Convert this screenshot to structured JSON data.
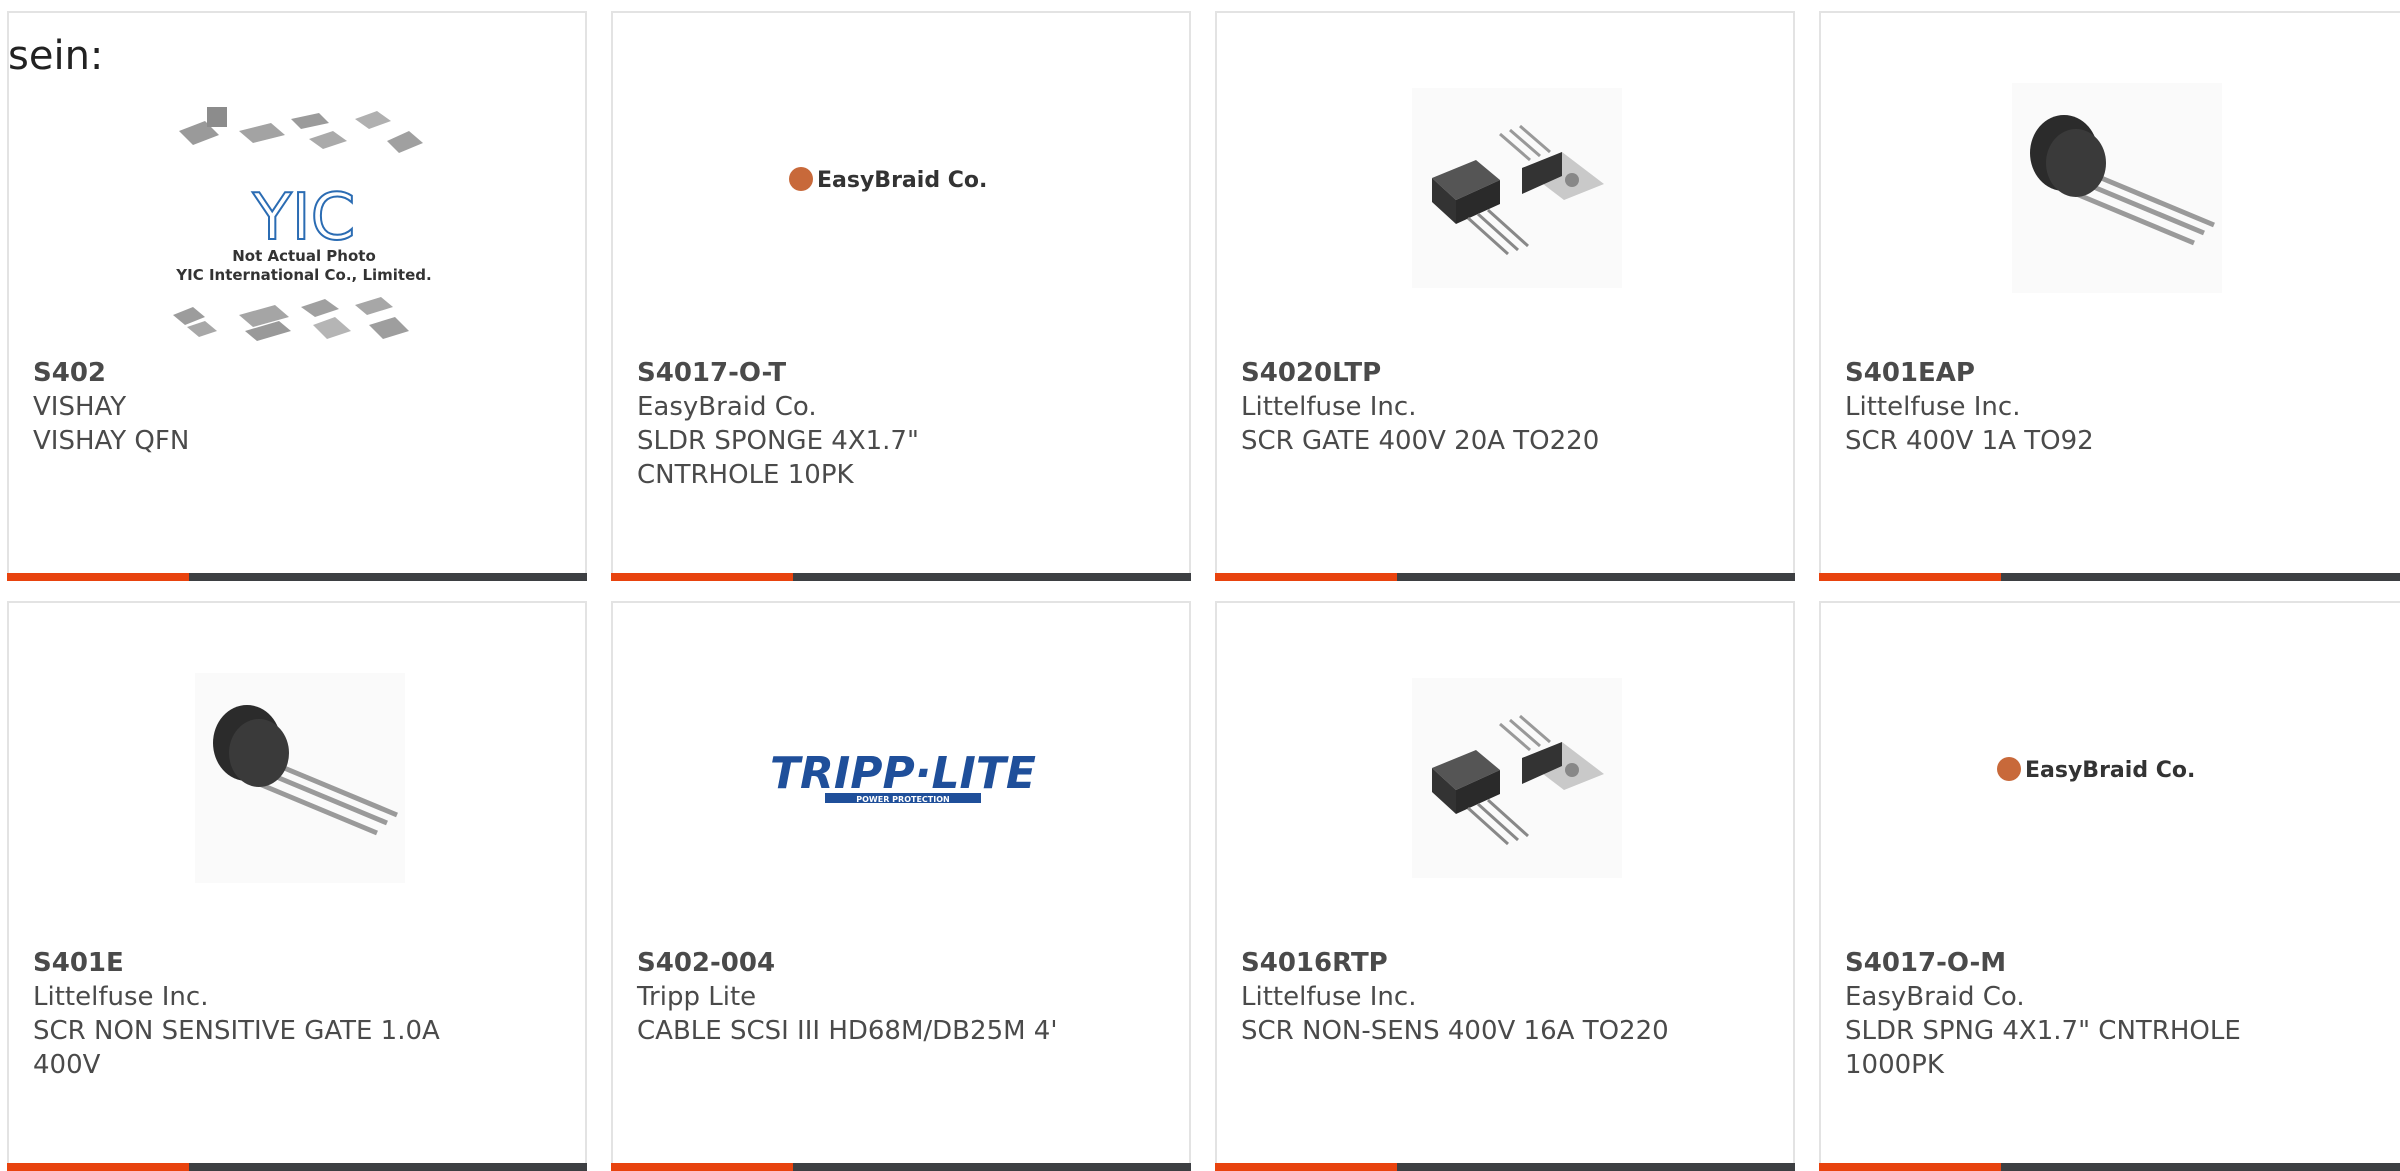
{
  "page": {
    "heading": "sein:"
  },
  "colors": {
    "accent_bar": "#e8430e",
    "dark_bar": "#3d3f42",
    "text": "#4a4a4a",
    "card_border": "#e3e3e3"
  },
  "placeholder_image": {
    "line1": "Not Actual Photo",
    "line2": "YIC International Co., Limited.",
    "logo": "YIC"
  },
  "logos": {
    "easybraid": "EasyBraid Co.",
    "tripplite": "TRIPP·LITE",
    "tripplite_tagline": "POWER PROTECTION"
  },
  "products": [
    {
      "part_number": "S402",
      "manufacturer": "VISHAY",
      "description": "VISHAY QFN",
      "image": "placeholder-chips"
    },
    {
      "part_number": "S4017-O-T",
      "manufacturer": "EasyBraid Co.",
      "description": "SLDR SPONGE 4X1.7\" CNTRHOLE 10PK",
      "image": "easybraid-logo"
    },
    {
      "part_number": "S4020LTP",
      "manufacturer": "Littelfuse Inc.",
      "description": "SCR GATE 400V 20A TO220",
      "image": "to220-package"
    },
    {
      "part_number": "S401EAP",
      "manufacturer": "Littelfuse Inc.",
      "description": "SCR 400V 1A TO92",
      "image": "to92-package"
    },
    {
      "part_number": "S401E",
      "manufacturer": "Littelfuse Inc.",
      "description": "SCR NON SENSITIVE GATE 1.0A 400V",
      "image": "to92-package"
    },
    {
      "part_number": "S402-004",
      "manufacturer": "Tripp Lite",
      "description": "CABLE SCSI III HD68M/DB25M 4'",
      "image": "tripplite-logo"
    },
    {
      "part_number": "S4016RTP",
      "manufacturer": "Littelfuse Inc.",
      "description": "SCR NON-SENS 400V 16A TO220",
      "image": "to220-package"
    },
    {
      "part_number": "S4017-O-M",
      "manufacturer": "EasyBraid Co.",
      "description": "SLDR SPNG 4X1.7\" CNTRHOLE 1000PK",
      "image": "easybraid-logo"
    }
  ]
}
